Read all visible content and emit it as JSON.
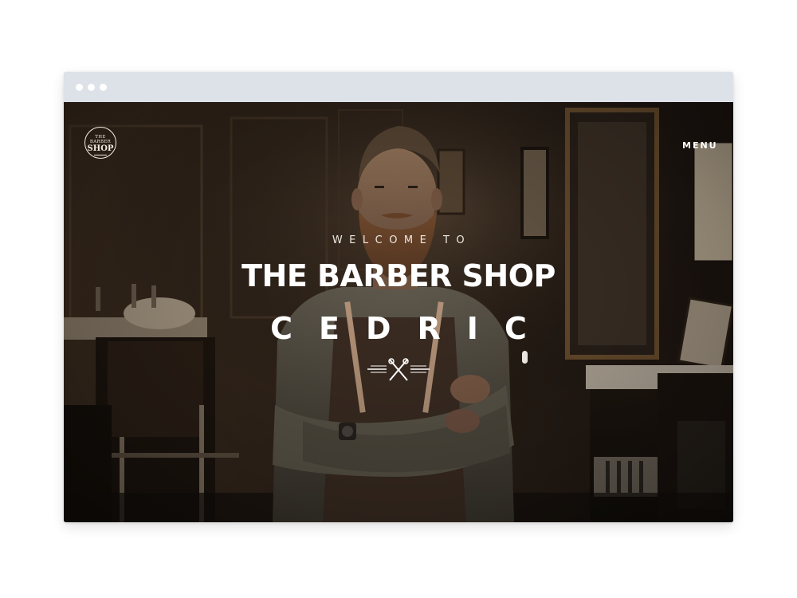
{
  "header": {
    "logo_top": "THE BARBER",
    "logo_main": "SHOP",
    "menu_label": "MENU"
  },
  "hero": {
    "welcome": "WELCOME TO",
    "title": "THE BARBER SHOP",
    "subtitle": "CEDRIC"
  },
  "colors": {
    "browser_bar": "#dde2e8",
    "text": "#ffffff",
    "hero_tone": "#2a1e14"
  },
  "icons": {
    "emblem": "scissors-razor-emblem-icon",
    "scroll": "scroll-indicator-icon",
    "logo": "barber-shop-logo"
  }
}
